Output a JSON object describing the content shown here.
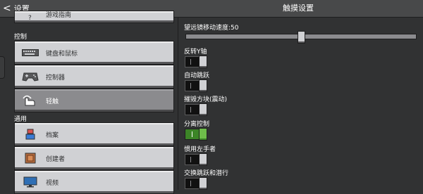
{
  "header": {
    "back_chevron": "<",
    "back_label": "设置",
    "title": "触摸设置"
  },
  "sidebar": {
    "top_item": {
      "label": "游戏指南",
      "icon": "question-icon"
    },
    "sections": [
      {
        "label": "控制",
        "items": [
          {
            "label": "键盘和鼠标",
            "icon": "keyboard-icon",
            "selected": false
          },
          {
            "label": "控制器",
            "icon": "controller-icon",
            "selected": false
          },
          {
            "label": "轻触",
            "icon": "touch-icon",
            "selected": true
          }
        ]
      },
      {
        "label": "通用",
        "items": [
          {
            "label": "档案",
            "icon": "profile-icon",
            "selected": false
          },
          {
            "label": "创建者",
            "icon": "creator-icon",
            "selected": false
          },
          {
            "label": "视频",
            "icon": "video-icon",
            "selected": false
          }
        ]
      }
    ]
  },
  "settings": {
    "spyglass_speed": {
      "label": "望远镜移动速度:50",
      "value": 50,
      "min": 0,
      "max": 100
    },
    "invert_y": {
      "label": "反转Y轴",
      "on": false
    },
    "auto_jump": {
      "label": "自动跳跃",
      "on": false
    },
    "destroy_block_vibration": {
      "label": "摧毁方块(震动)",
      "on": false
    },
    "split_controls": {
      "label": "分离控制",
      "on": true
    },
    "left_handed": {
      "label": "惯用左手者",
      "on": false
    },
    "swap_jump_sneak": {
      "label": "交换跳跃和潜行",
      "on": false
    }
  },
  "colors": {
    "background": "#313233",
    "button": "#d0d1d4",
    "button_selected": "#8b8b8e",
    "toggle_on": "#3c8527"
  }
}
